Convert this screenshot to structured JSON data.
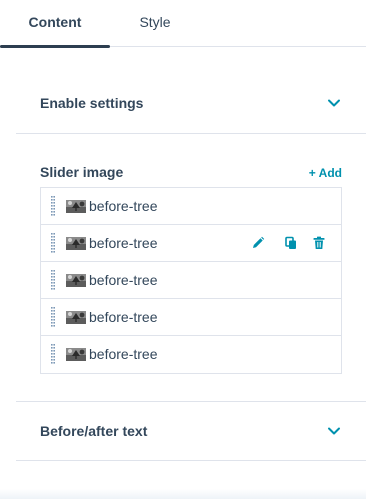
{
  "tabs": [
    {
      "label": "Content",
      "active": true
    },
    {
      "label": "Style",
      "active": false
    }
  ],
  "sections": {
    "enable_settings": {
      "title": "Enable settings",
      "icon": "chevron-down-icon"
    },
    "slider_image": {
      "title": "Slider image",
      "add_label": "+ Add"
    },
    "before_after_text": {
      "title": "Before/after text",
      "icon": "chevron-down-icon"
    }
  },
  "slider_items": [
    {
      "label": "before-tree"
    },
    {
      "label": "before-tree"
    },
    {
      "label": "before-tree"
    },
    {
      "label": "before-tree"
    },
    {
      "label": "before-tree"
    }
  ],
  "row_actions": [
    "pencil-icon",
    "copy-icon",
    "trash-icon"
  ],
  "colors": {
    "text": "#33475b",
    "accent": "#0091ae",
    "border": "#dfe3eb",
    "tab_indicator": "#2d3e50"
  }
}
